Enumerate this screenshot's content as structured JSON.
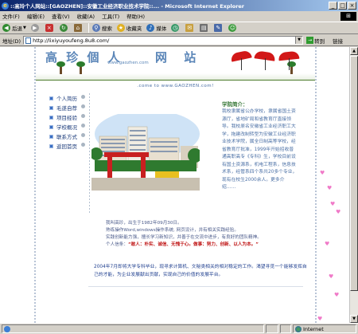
{
  "window": {
    "title": "::高玲个人网站::[GAOZHEN]::安徽工业经济职业技术学院::... - Microsoft Internet Explorer",
    "min": "_",
    "max": "□",
    "close": "×"
  },
  "menu": {
    "items": [
      "文件(F)",
      "编辑(E)",
      "查看(V)",
      "收藏(A)",
      "工具(T)",
      "帮助(H)"
    ]
  },
  "toolbar": {
    "back": "后退",
    "forward": "",
    "stop": "",
    "refresh": "",
    "home": "",
    "search": "搜索",
    "favorites": "收藏夹",
    "media": "媒体"
  },
  "address": {
    "label": "地址(D)",
    "url": "http://lixiyuyoufeng.8u8.com/",
    "go": "转到",
    "links": "链接"
  },
  "banner": {
    "logo_text": "高 珍 個 人",
    "logo_text2": "网 站",
    "logo_url": "www.gaozhen.com"
  },
  "welcome": ".come to www.GAOZHEN.com!",
  "nav": {
    "items": [
      "个人简历",
      "毛遂自荐",
      "项目经验",
      "学校概况",
      "联系方式",
      "返回首页"
    ]
  },
  "about": {
    "title": "学院简介：",
    "text": "我校隶属省公办学校，隶属省国土资源厅，省地矿局和省教育厅直接领导。我校原名安徽省工业经济职工大学，拖建改制转型为安徽工业经济职业技术学院，属全日制高等学校，经省教育厅批准，1999年开始招收普通高职高专《专科》生，学校目前设有国土资源系，机电工程系，信息技术系，经管系四个系共20多个专业，现有在校生2000余人。更多介绍",
    "more": "……"
  },
  "intro": {
    "line1": "我叫高珍，出生于1982年09月30日。",
    "line2": "熟练操作Word,windows操作系统, 网页设计，并有相关实践经验。",
    "line3": "实践创新能力强，擅长学习新知识，并善于在交流中进步，有良好的团队精神。",
    "motto_label": "个人信条：",
    "motto": "“敢人：朴实、诚信、无愧于心。做事：努力、创新、以人为本。”"
  },
  "plan": "2004年7月即将大学专科毕业，现寻求计算机、文秘类相关的相对稳定的工作。渴望寻觅一个能够发挥自己的才能，为企业发展献出贡献，实现自己的价值的发展平台。",
  "status": {
    "text": "",
    "zone": "Internet"
  },
  "colors": {
    "title_gradient_start": "#0a246a",
    "title_gradient_end": "#a6caf0",
    "accent_blue": "#4a6fa5",
    "motto_red": "#c01818",
    "nav_bullet": "#3b6fc4"
  }
}
